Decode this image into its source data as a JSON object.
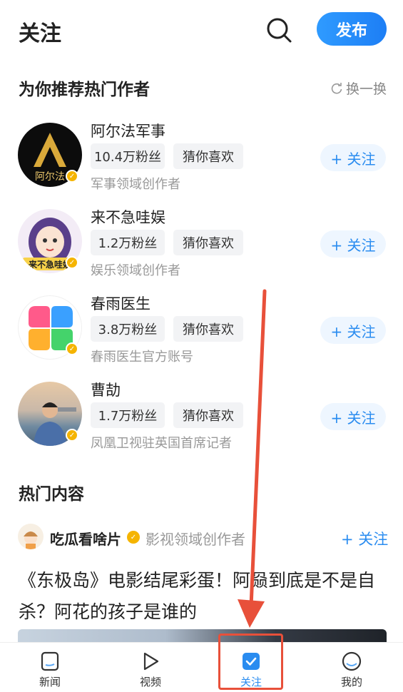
{
  "header": {
    "title": "关注",
    "publish_label": "发布",
    "search_icon": "search-icon"
  },
  "recommend": {
    "title": "为你推荐热门作者",
    "refresh_label": "换一换",
    "authors": [
      {
        "name": "阿尔法军事",
        "fans": "10.4万粉丝",
        "tag": "猜你喜欢",
        "desc": "军事领域创作者",
        "follow": "+ 关注",
        "avatar_text": "阿尔法"
      },
      {
        "name": "来不急哇娱",
        "fans": "1.2万粉丝",
        "tag": "猜你喜欢",
        "desc": "娱乐领域创作者",
        "follow": "+ 关注",
        "avatar_text": "来不急哇娱"
      },
      {
        "name": "春雨医生",
        "fans": "3.8万粉丝",
        "tag": "猜你喜欢",
        "desc": "春雨医生官方账号",
        "follow": "+ 关注"
      },
      {
        "name": "曹劼",
        "fans": "1.7万粉丝",
        "tag": "猜你喜欢",
        "desc": "凤凰卫视驻英国首席记者",
        "follow": "+ 关注"
      }
    ]
  },
  "hot": {
    "title": "热门内容",
    "post": {
      "author": "吃瓜看啥片",
      "domain": "影视领域创作者",
      "follow": "+ 关注",
      "text": "《东极岛》电影结尾彩蛋！阿赑到底是不是自杀？阿花的孩子是谁的"
    }
  },
  "tabbar": {
    "tabs": [
      {
        "label": "新闻"
      },
      {
        "label": "视频"
      },
      {
        "label": "关注"
      },
      {
        "label": "我的"
      }
    ]
  },
  "colors": {
    "accent": "#2a8cf0",
    "verified": "#f5b400",
    "annotation": "#e8503a"
  }
}
